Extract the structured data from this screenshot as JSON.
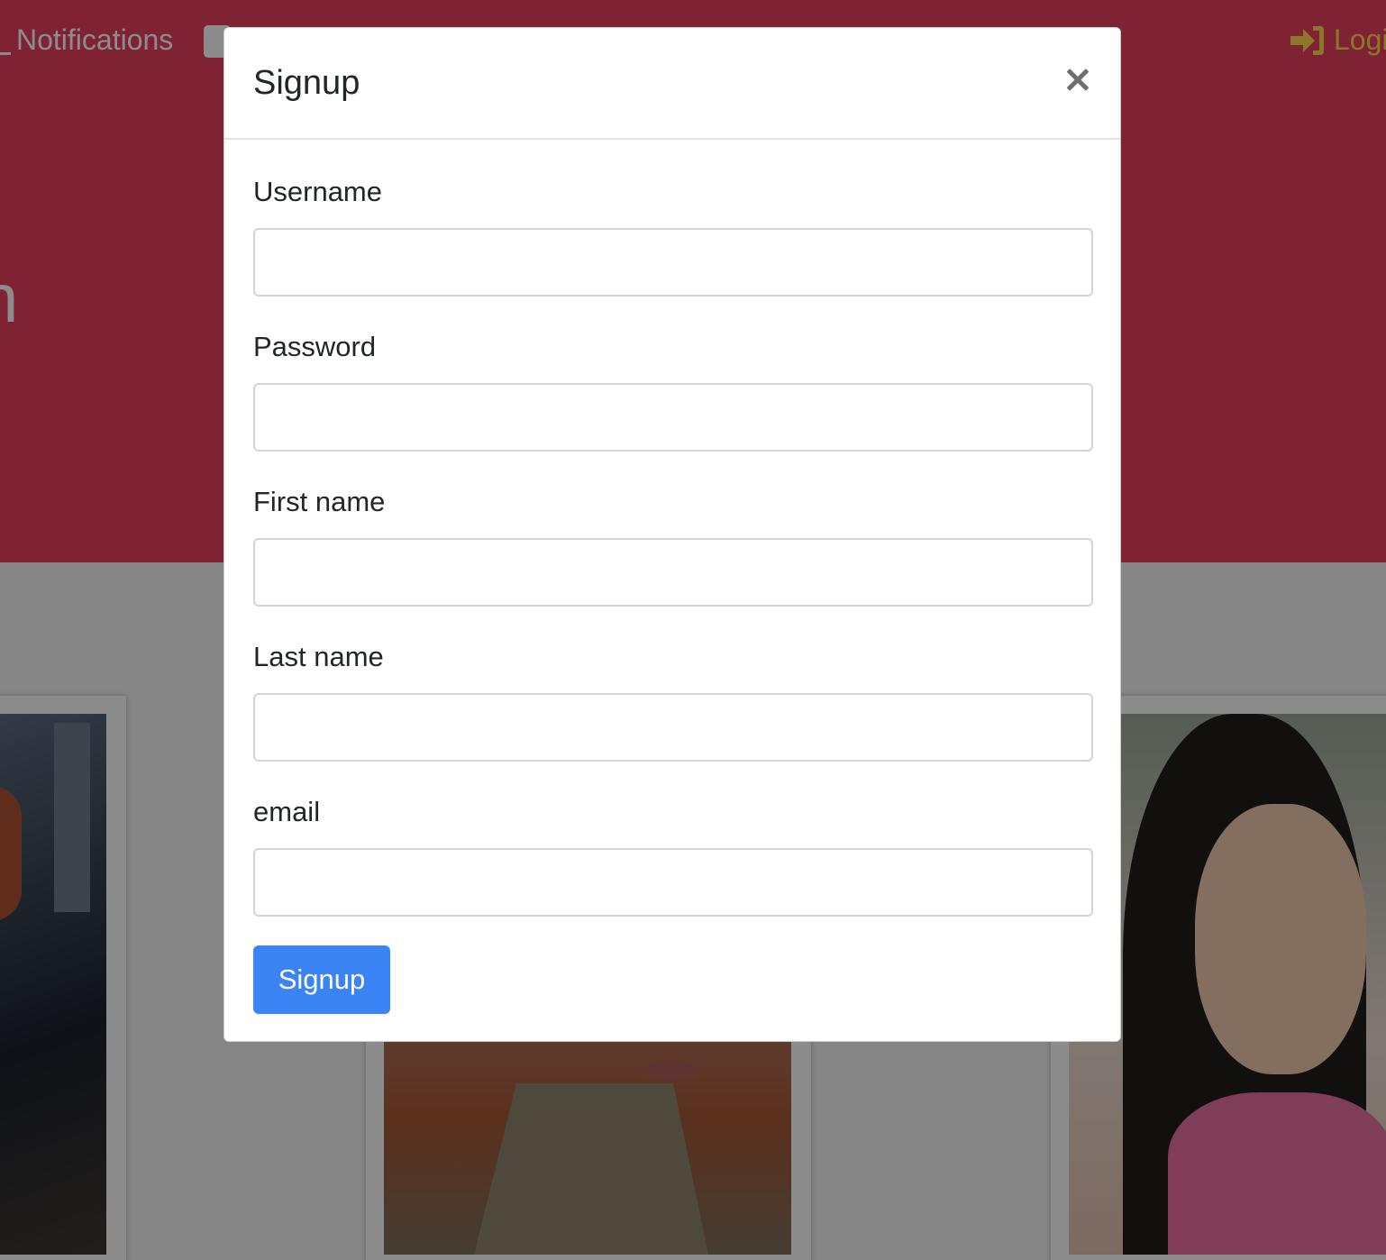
{
  "navbar": {
    "notifications_label": "Notifications",
    "login_label": "Login"
  },
  "hero": {
    "text": "n"
  },
  "modal": {
    "title": "Signup",
    "close_glyph": "×",
    "fields": [
      {
        "label": "Username",
        "value": ""
      },
      {
        "label": "Password",
        "value": ""
      },
      {
        "label": "First name",
        "value": ""
      },
      {
        "label": "Last name",
        "value": ""
      },
      {
        "label": "email",
        "value": ""
      }
    ],
    "submit_label": "Signup"
  },
  "colors": {
    "hero_background": "#e8405f",
    "login_link": "#ffd84a",
    "primary_button": "#3a84f5"
  }
}
